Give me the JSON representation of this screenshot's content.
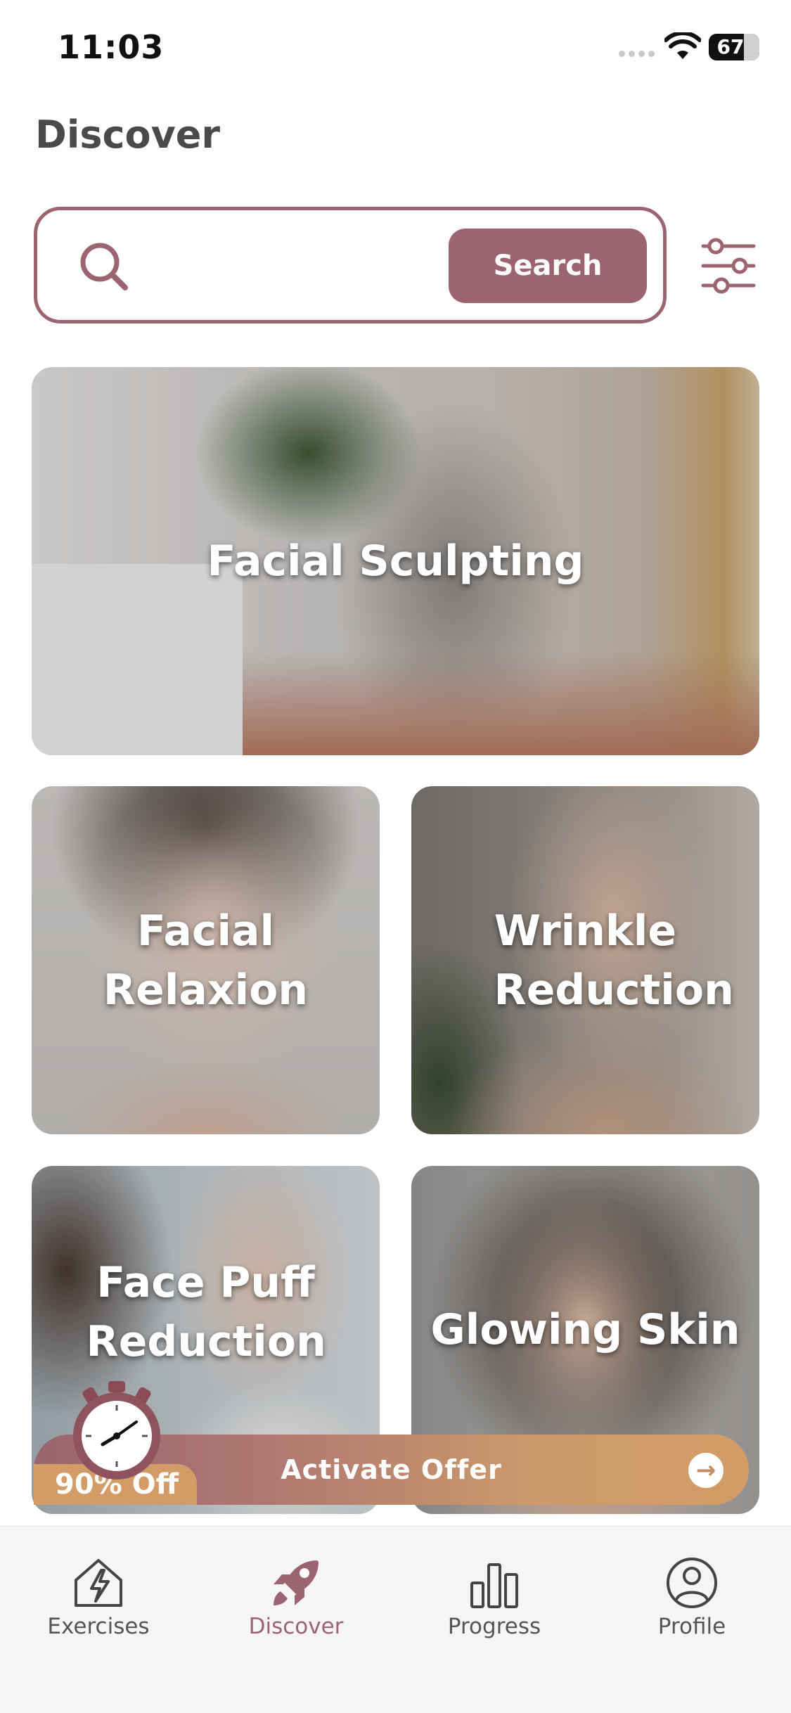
{
  "status_bar": {
    "time": "11:03",
    "battery": "67"
  },
  "header": {
    "title": "Discover"
  },
  "search": {
    "placeholder": "",
    "button_label": "Search"
  },
  "categories": [
    {
      "label": "Facial Sculpting"
    },
    {
      "label": "Facial Relaxion"
    },
    {
      "label": "Wrinkle Reduction"
    },
    {
      "label": "Face Puff Reduction"
    },
    {
      "label": "Glowing Skin"
    }
  ],
  "offer": {
    "label": "Activate Offer",
    "discount": "90% Off"
  },
  "nav": {
    "items": [
      {
        "label": "Exercises",
        "icon": "lightning-house-icon"
      },
      {
        "label": "Discover",
        "icon": "rocket-icon",
        "active": true
      },
      {
        "label": "Progress",
        "icon": "bar-chart-icon"
      },
      {
        "label": "Profile",
        "icon": "user-circle-icon"
      }
    ]
  },
  "colors": {
    "accent": "#9b6470",
    "offer_orange": "#d39c66",
    "text": "#4a4a4a"
  }
}
